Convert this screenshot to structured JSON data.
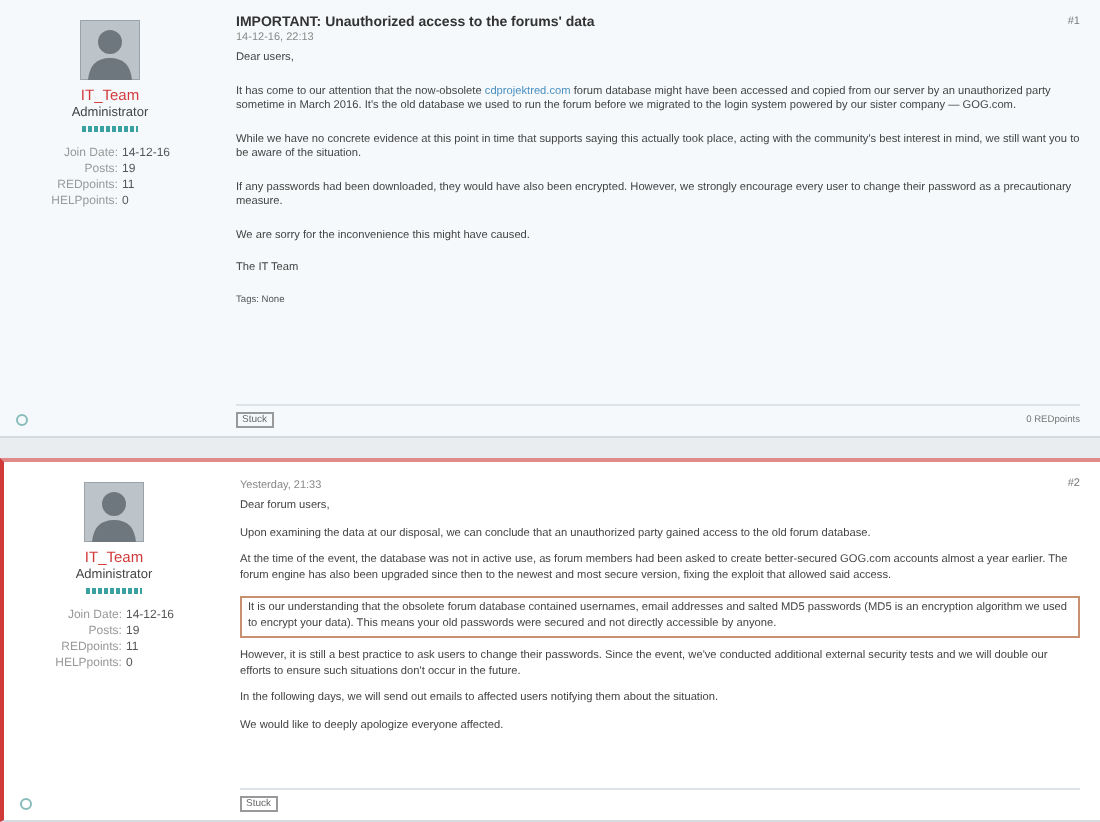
{
  "posts": [
    {
      "highlighted": false,
      "title": "IMPORTANT: Unauthorized access to the forums' data",
      "date": "14-12-16, 22:13",
      "number": "#1",
      "author": {
        "name": "IT_Team",
        "role": "Administrator",
        "stats": [
          {
            "label": "Join Date:",
            "value": "14-12-16"
          },
          {
            "label": "Posts:",
            "value": "19"
          },
          {
            "label": "REDpoints:",
            "value": "11"
          },
          {
            "label": "HELPpoints:",
            "value": "0"
          }
        ]
      },
      "paragraphs": [
        {
          "kind": "text",
          "text": "Dear users,"
        },
        {
          "kind": "link",
          "before": "It has come to our attention that the now-obsolete ",
          "link": "cdprojektred.com",
          "after": " forum database might have been accessed and copied from our server by an unauthorized party sometime in March 2016. It's the old database we used to run the forum before we migrated to the login system powered by our sister company — GOG.com."
        },
        {
          "kind": "text",
          "text": "While we have no concrete evidence at this point in time that supports saying this actually took place, acting with the community's best interest in mind, we still want you to be aware of the situation."
        },
        {
          "kind": "text",
          "text": "If any passwords had been downloaded, they would have also been encrypted. However, we strongly encourage every user to change their password as a precautionary measure."
        },
        {
          "kind": "text",
          "text": "We are sorry for the inconvenience this might have caused."
        },
        {
          "kind": "text",
          "text": "The IT Team"
        }
      ],
      "tags": "Tags: None",
      "stuck": "Stuck",
      "points": "0 REDpoints"
    },
    {
      "highlighted": true,
      "date": "Yesterday, 21:33",
      "number": "#2",
      "author": {
        "name": "IT_Team",
        "role": "Administrator",
        "stats": [
          {
            "label": "Join Date:",
            "value": "14-12-16"
          },
          {
            "label": "Posts:",
            "value": "19"
          },
          {
            "label": "REDpoints:",
            "value": "11"
          },
          {
            "label": "HELPpoints:",
            "value": "0"
          }
        ]
      },
      "paragraphs": [
        {
          "kind": "text",
          "text": "Dear forum users,"
        },
        {
          "kind": "text",
          "text": "Upon examining the data at our disposal, we can conclude that an unauthorized party gained access to the old forum database."
        },
        {
          "kind": "text",
          "text": "At the time of the event, the database was not in active use, as forum members had been asked to create better-secured GOG.com accounts almost a year earlier. The forum engine has also been upgraded since then to the newest and most secure version, fixing the exploit that allowed said access."
        },
        {
          "kind": "boxed",
          "text": "It is our understanding that the obsolete forum database contained usernames, email addresses and salted MD5 passwords (MD5 is an encryption algorithm we used to encrypt your data). This means your old passwords were secured and not directly accessible by anyone."
        },
        {
          "kind": "text",
          "text": "However, it is still a best practice to ask users to change their passwords. Since the event, we've conducted additional external security tests and we will double our efforts to ensure such situations don't occur in the future."
        },
        {
          "kind": "text",
          "text": "In the following days, we will send out emails to affected users notifying them about the situation."
        },
        {
          "kind": "text",
          "text": "We would like to deeply apologize everyone affected."
        }
      ],
      "stuck": "Stuck"
    }
  ]
}
